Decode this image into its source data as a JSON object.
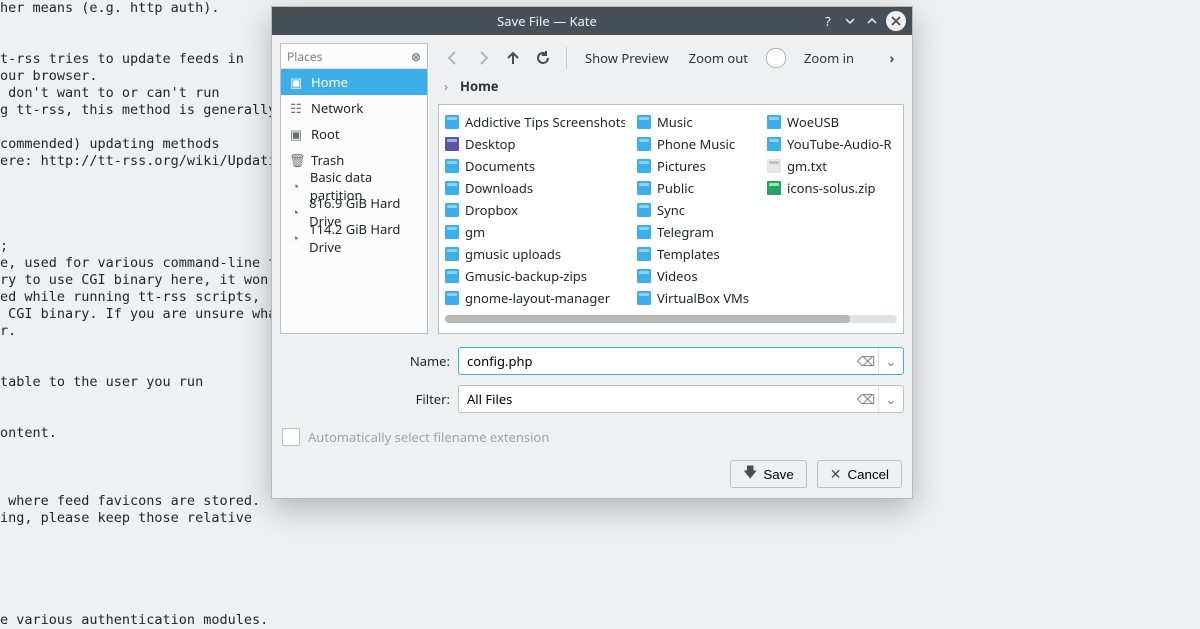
{
  "bg_text": "her means (e.g. http auth).\n\n\nt-rss tries to update feeds in\nour browser.\n don't want to or can't run\ng tt-rss, this method is generally\n\ncommended) updating methods\nere: http://tt-rss.org/wiki/UpdatingF\n\n\n\n\n;\ne, used for various command-line tt-r\nry to use CGI binary here, it won't w\ned while running tt-rss scripts,\n CGI binary. If you are unsure what t\nr.\n\n\ntable to the user you run\n\n\nontent.\n\n\n\n where feed favicons are stored.\ning, please keep those relative\n\n\n\n\n\ne various authentication modules.",
  "title": "Save File — Kate",
  "places_header": "Places",
  "places": [
    {
      "label": "Home",
      "icon": "folder"
    },
    {
      "label": "Network",
      "icon": "net"
    },
    {
      "label": "Root",
      "icon": "folder"
    },
    {
      "label": "Trash",
      "icon": "trash"
    },
    {
      "label": "Basic data partition",
      "icon": "disk"
    },
    {
      "label": "816.9 GiB Hard Drive",
      "icon": "disk"
    },
    {
      "label": "114.2 GiB Hard Drive",
      "icon": "disk"
    }
  ],
  "toolbar": {
    "show_preview": "Show Preview",
    "zoom_out": "Zoom out",
    "zoom_in": "Zoom in"
  },
  "breadcrumb": {
    "arrow": "›",
    "current": "Home"
  },
  "cols": [
    [
      "Addictive Tips Screenshots",
      "Desktop",
      "Documents",
      "Downloads",
      "Dropbox",
      "gm",
      "gmusic uploads",
      "Gmusic-backup-zips",
      "gnome-layout-manager"
    ],
    [
      "Music",
      "Phone Music",
      "Pictures",
      "Public",
      "Sync",
      "Telegram",
      "Templates",
      "Videos",
      "VirtualBox VMs"
    ],
    [
      "WoeUSB",
      "YouTube-Audio-R",
      "gm.txt",
      "icons-solus.zip"
    ]
  ],
  "col3_icons": [
    "folder",
    "folder",
    "txt",
    "zip"
  ],
  "name_label": "Name:",
  "name_value": "config.php",
  "filter_label": "Filter:",
  "filter_value": "All Files",
  "auto_ext": "Automatically select filename extension",
  "btn_save": "Save",
  "btn_cancel": "Cancel"
}
